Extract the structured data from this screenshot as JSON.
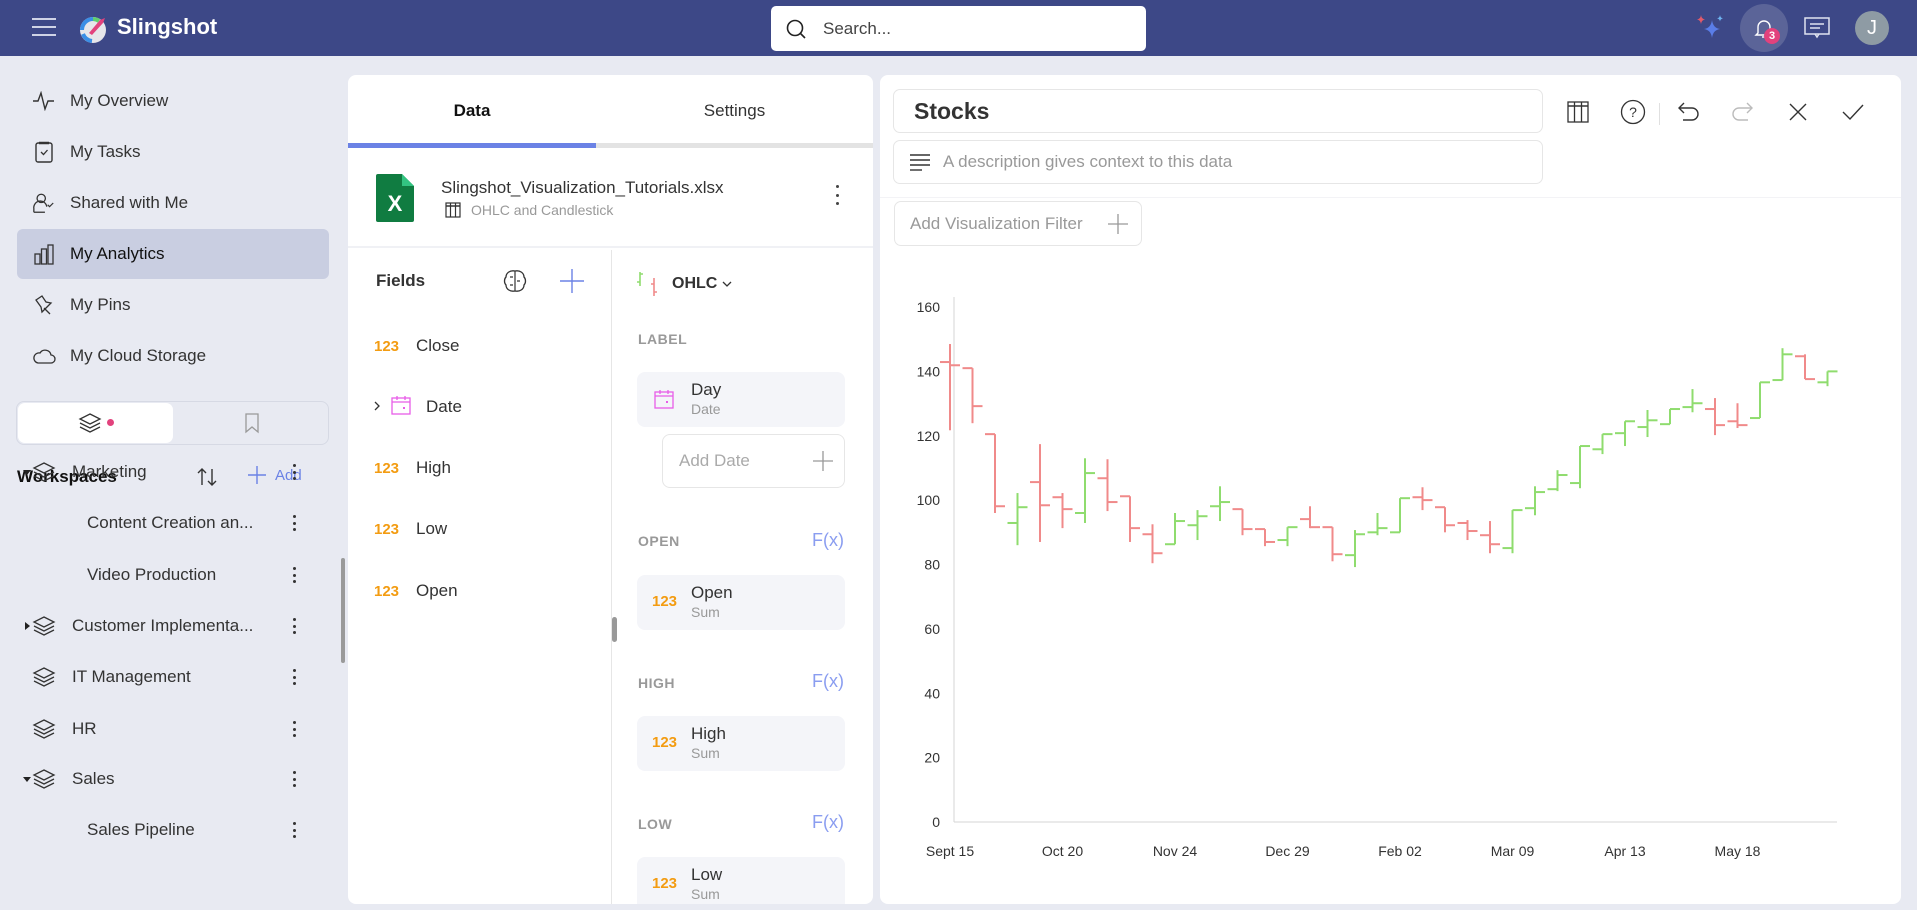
{
  "app": {
    "brand": "Slingshot",
    "search_placeholder": "Search...",
    "notifications_count": "3",
    "avatar_initial": "J"
  },
  "sidebar": {
    "nav": [
      {
        "label": "My Overview",
        "icon": "activity-icon"
      },
      {
        "label": "My Tasks",
        "icon": "clipboard-check-icon"
      },
      {
        "label": "Shared with Me",
        "icon": "user-check-icon"
      },
      {
        "label": "My Analytics",
        "icon": "bar-chart-icon",
        "active": true
      },
      {
        "label": "My Pins",
        "icon": "pin-icon"
      },
      {
        "label": "My Cloud Storage",
        "icon": "cloud-icon"
      }
    ],
    "workspaces_title": "Workspaces",
    "add_label": "Add",
    "workspaces": [
      {
        "label": "Marketing",
        "level": 0,
        "expanded": true
      },
      {
        "label": "Content Creation an...",
        "level": 1
      },
      {
        "label": "Video Production",
        "level": 1
      },
      {
        "label": "Customer Implementa...",
        "level": 0,
        "expanded": false
      },
      {
        "label": "IT Management",
        "level": 0
      },
      {
        "label": "HR",
        "level": 0
      },
      {
        "label": "Sales",
        "level": 0,
        "expanded": true
      },
      {
        "label": "Sales Pipeline",
        "level": 1
      }
    ]
  },
  "data_panel": {
    "tabs": [
      {
        "label": "Data",
        "active": true
      },
      {
        "label": "Settings"
      }
    ],
    "source": {
      "file": "Slingshot_Visualization_Tutorials.xlsx",
      "sheet": "OHLC and Candlestick"
    },
    "fields_title": "Fields",
    "fields": [
      {
        "label": "Close",
        "type": "123"
      },
      {
        "label": "Date",
        "type": "date"
      },
      {
        "label": "High",
        "type": "123"
      },
      {
        "label": "Low",
        "type": "123"
      },
      {
        "label": "Open",
        "type": "123"
      }
    ],
    "chart_type": "OHLC",
    "sections": {
      "label": {
        "title": "LABEL",
        "item": "Day",
        "sub": "Date",
        "add_placeholder": "Add Date"
      },
      "open": {
        "title": "OPEN",
        "fx": "F(x)",
        "item": "Open",
        "sub": "Sum",
        "type": "123"
      },
      "high": {
        "title": "HIGH",
        "fx": "F(x)",
        "item": "High",
        "sub": "Sum",
        "type": "123"
      },
      "low": {
        "title": "LOW",
        "fx": "F(x)",
        "item": "Low",
        "sub": "Sum",
        "type": "123"
      }
    }
  },
  "viz": {
    "title": "Stocks",
    "description_placeholder": "A description gives context to this data",
    "filter_label": "Add Visualization Filter"
  },
  "colors": {
    "header": "#3d4887",
    "accent": "#6b82e5",
    "up": "#8fdc6e",
    "down": "#f08a8a",
    "number_type": "#f39c12",
    "date_type": "#e85de8"
  },
  "chart_data": {
    "type": "ohlc",
    "title": "Stocks",
    "xlabel": "",
    "ylabel": "",
    "ylim": [
      0,
      160
    ],
    "yticks": [
      0,
      20,
      40,
      60,
      80,
      100,
      120,
      140,
      160
    ],
    "xtick_labels": [
      "Sept 15",
      "Oct 20",
      "Nov 24",
      "Dec 29",
      "Feb 02",
      "Mar 09",
      "Apr 13",
      "May 18"
    ],
    "xtick_every": 5,
    "grid": false,
    "bars": [
      {
        "o": 142.9,
        "h": 148.5,
        "l": 121.7,
        "c": 141.9
      },
      {
        "o": 141.0,
        "h": 141.0,
        "l": 123.9,
        "c": 129.2
      },
      {
        "o": 120.5,
        "h": 120.5,
        "l": 96.0,
        "c": 98.1
      },
      {
        "o": 92.9,
        "h": 102.2,
        "l": 86.0,
        "c": 97.8
      },
      {
        "o": 105.6,
        "h": 117.4,
        "l": 87.0,
        "c": 98.4
      },
      {
        "o": 100.9,
        "h": 102.2,
        "l": 91.3,
        "c": 97.2
      },
      {
        "o": 96.0,
        "h": 113.0,
        "l": 92.9,
        "c": 108.4
      },
      {
        "o": 106.8,
        "h": 112.7,
        "l": 96.6,
        "c": 99.4
      },
      {
        "o": 101.2,
        "h": 101.2,
        "l": 87.0,
        "c": 91.3
      },
      {
        "o": 89.4,
        "h": 92.5,
        "l": 80.4,
        "c": 83.5
      },
      {
        "o": 86.3,
        "h": 96.0,
        "l": 86.3,
        "c": 93.5
      },
      {
        "o": 92.2,
        "h": 96.9,
        "l": 87.6,
        "c": 95.0
      },
      {
        "o": 98.1,
        "h": 104.3,
        "l": 93.5,
        "c": 99.4
      },
      {
        "o": 97.2,
        "h": 97.2,
        "l": 89.1,
        "c": 91.0
      },
      {
        "o": 91.0,
        "h": 91.0,
        "l": 85.7,
        "c": 87.0
      },
      {
        "o": 87.6,
        "h": 91.6,
        "l": 85.7,
        "c": 91.6
      },
      {
        "o": 94.1,
        "h": 98.1,
        "l": 91.3,
        "c": 91.6
      },
      {
        "o": 91.6,
        "h": 91.6,
        "l": 81.0,
        "c": 83.2
      },
      {
        "o": 82.9,
        "h": 90.7,
        "l": 79.2,
        "c": 89.4
      },
      {
        "o": 90.0,
        "h": 96.0,
        "l": 89.1,
        "c": 91.3
      },
      {
        "o": 90.0,
        "h": 100.6,
        "l": 90.0,
        "c": 100.6
      },
      {
        "o": 100.9,
        "h": 104.0,
        "l": 96.9,
        "c": 100.0
      },
      {
        "o": 97.8,
        "h": 97.8,
        "l": 90.0,
        "c": 92.2
      },
      {
        "o": 92.9,
        "h": 93.8,
        "l": 87.6,
        "c": 90.4
      },
      {
        "o": 89.1,
        "h": 93.5,
        "l": 83.5,
        "c": 86.3
      },
      {
        "o": 85.1,
        "h": 96.9,
        "l": 83.5,
        "c": 96.9
      },
      {
        "o": 97.5,
        "h": 104.3,
        "l": 95.3,
        "c": 102.5
      },
      {
        "o": 103.4,
        "h": 109.3,
        "l": 102.8,
        "c": 107.8
      },
      {
        "o": 105.3,
        "h": 116.8,
        "l": 103.7,
        "c": 116.8
      },
      {
        "o": 115.8,
        "h": 120.5,
        "l": 114.3,
        "c": 120.5
      },
      {
        "o": 120.8,
        "h": 124.5,
        "l": 116.8,
        "c": 124.5
      },
      {
        "o": 122.7,
        "h": 128.0,
        "l": 119.6,
        "c": 124.8
      },
      {
        "o": 123.6,
        "h": 128.3,
        "l": 123.6,
        "c": 128.3
      },
      {
        "o": 128.9,
        "h": 134.5,
        "l": 127.3,
        "c": 130.1
      },
      {
        "o": 128.3,
        "h": 131.7,
        "l": 120.2,
        "c": 123.3
      },
      {
        "o": 124.5,
        "h": 130.1,
        "l": 122.4,
        "c": 123.3
      },
      {
        "o": 125.5,
        "h": 136.6,
        "l": 125.5,
        "c": 136.6
      },
      {
        "o": 137.3,
        "h": 147.2,
        "l": 137.3,
        "c": 145.3
      },
      {
        "o": 144.7,
        "h": 145.3,
        "l": 137.6,
        "c": 137.6
      },
      {
        "o": 136.6,
        "h": 140.0,
        "l": 135.4,
        "c": 140.0
      }
    ]
  }
}
